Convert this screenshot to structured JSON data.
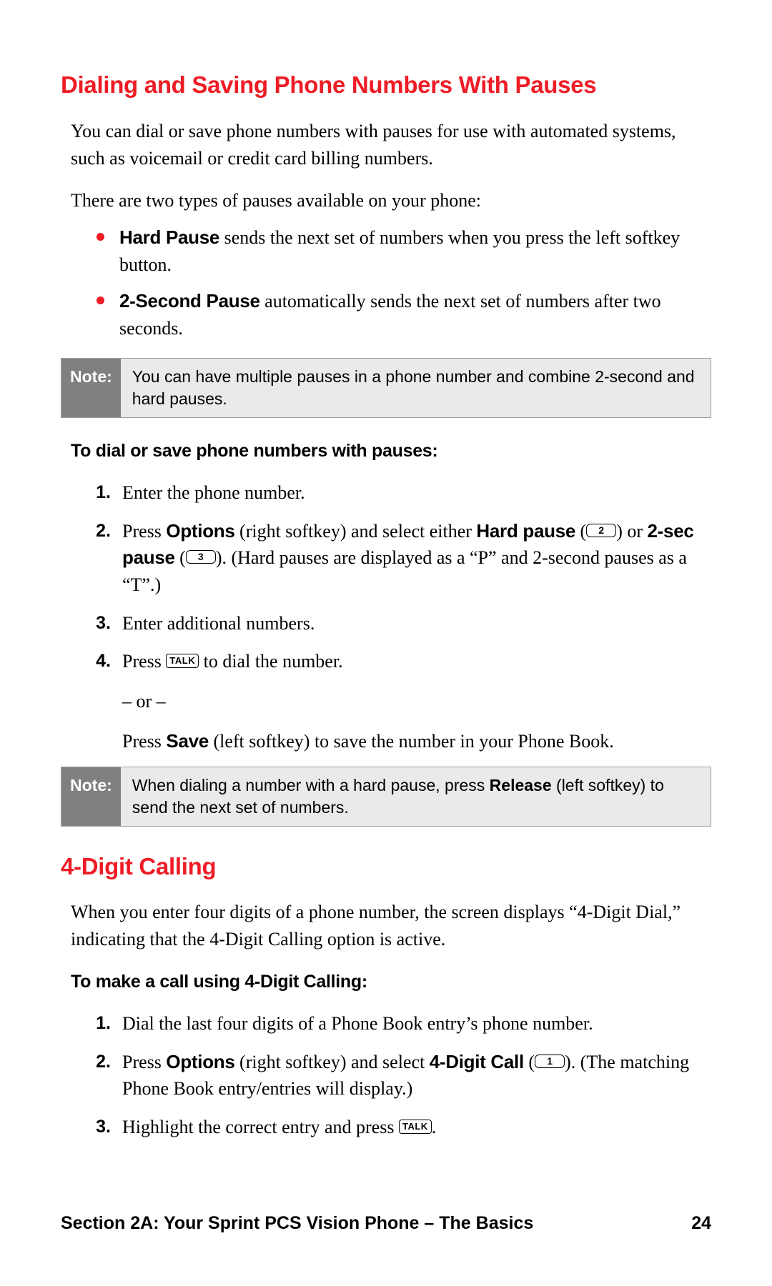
{
  "s1": {
    "heading": "Dialing and Saving Phone Numbers With Pauses",
    "p1": "You can dial or save phone numbers with pauses for use with automated systems, such as voicemail or credit card billing numbers.",
    "p2": "There are two types of pauses available on your phone:",
    "bul1_bold": "Hard Pause",
    "bul1_rest": " sends the next set of numbers when you press the left softkey button.",
    "bul2_bold": "2-Second Pause",
    "bul2_rest": " automatically sends the next set of numbers after two seconds.",
    "note1_label": "Note:",
    "note1_text": "You can have multiple pauses in a phone number and combine 2-second and hard pauses.",
    "sub": "To dial or save phone numbers with pauses:",
    "st1_n": "1.",
    "st1_t": "Enter the phone number.",
    "st2_n": "2.",
    "st2_a": "Press ",
    "st2_b": "Options",
    "st2_c": " (right softkey) and select either ",
    "st2_d": "Hard pause",
    "st2_e": " (",
    "st2_key1": "2",
    "st2_f": ") or ",
    "st2_g": "2-sec pause",
    "st2_h": " (",
    "st2_key2": "3",
    "st2_i": "). (Hard pauses are displayed as a “P” and 2-second pauses as a “T”.)",
    "st3_n": "3.",
    "st3_t": "Enter additional numbers.",
    "st4_n": "4.",
    "st4_a": "Press ",
    "st4_key": "TALK",
    "st4_b": " to dial the number.",
    "st4_or": "– or –",
    "st4_c": "Press ",
    "st4_d": "Save",
    "st4_e": " (left softkey) to save the number in your Phone Book.",
    "note2_label": "Note:",
    "note2_a": "When dialing a number with a hard pause, press ",
    "note2_b": "Release",
    "note2_c": " (left softkey) to send the next set of numbers."
  },
  "s2": {
    "heading": "4-Digit Calling",
    "p1": "When you enter four digits of a phone number, the screen displays “4-Digit Dial,” indicating that the 4-Digit Calling option is active.",
    "sub": "To make a call using 4-Digit Calling:",
    "st1_n": "1.",
    "st1_t": "Dial the last four digits of a Phone Book entry’s phone number.",
    "st2_n": "2.",
    "st2_a": "Press ",
    "st2_b": "Options",
    "st2_c": " (right softkey) and select ",
    "st2_d": "4-Digit Call",
    "st2_e": " (",
    "st2_key": "1",
    "st2_f": "). (The matching Phone Book entry/entries will display.)",
    "st3_n": "3.",
    "st3_a": "Highlight the correct entry and press ",
    "st3_key": "TALK",
    "st3_b": "."
  },
  "footer": {
    "section": "Section 2A: Your Sprint PCS Vision Phone – The Basics",
    "page": "24"
  }
}
